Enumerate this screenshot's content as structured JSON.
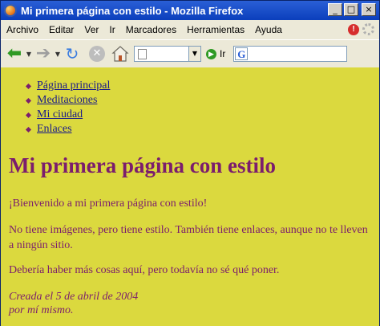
{
  "window": {
    "title": "Mi primera página con estilo - Mozilla Firefox"
  },
  "titlebar_buttons": {
    "minimize": "_",
    "maximize": "□",
    "close": "×"
  },
  "menu": [
    {
      "label": "Archivo"
    },
    {
      "label": "Editar"
    },
    {
      "label": "Ver"
    },
    {
      "label": "Ir"
    },
    {
      "label": "Marcadores"
    },
    {
      "label": "Herramientas"
    },
    {
      "label": "Ayuda"
    }
  ],
  "toolbar": {
    "go_label": "Ir",
    "url_value": "",
    "search_value": ""
  },
  "page": {
    "nav_links": [
      {
        "label": "Página principal"
      },
      {
        "label": "Meditaciones"
      },
      {
        "label": "Mi ciudad"
      },
      {
        "label": "Enlaces"
      }
    ],
    "heading": "Mi primera página con estilo",
    "paragraphs": [
      "¡Bienvenido a mi primera página con estilo!",
      "No tiene imágenes, pero tiene estilo. También tiene enlaces, aunque no te lleven a ningún sitio.",
      "Debería haber más cosas aquí, pero todavía no sé qué poner."
    ],
    "address_line1": "Creada el 5 de abril de 2004",
    "address_line2": "por mí mismo."
  },
  "colors": {
    "page_background": "#dbd93e",
    "text": "#7b1d6d",
    "link": "#1a1a8a",
    "titlebar": "#0b3fbc"
  }
}
